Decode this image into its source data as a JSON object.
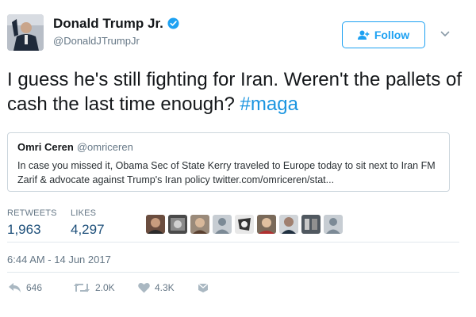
{
  "author": {
    "name": "Donald Trump Jr.",
    "handle": "@DonaldJTrumpJr",
    "avatar_icon": "profile-photo",
    "verified_icon": "verified-badge-icon",
    "verified_color": "#1da1f2"
  },
  "follow": {
    "label": "Follow",
    "icon": "add-person-icon",
    "color": "#1da1f2"
  },
  "menu": {
    "icon": "chevron-down-icon"
  },
  "tweet": {
    "text": "I guess he's still fighting for Iran. Weren't the pallets of cash the last time enough? ",
    "hashtag": "#maga",
    "hashtag_color": "#1b95e0"
  },
  "quote": {
    "name": "Omri Ceren",
    "handle": "@omriceren",
    "text": "In case you missed it, Obama Sec of State Kerry traveled to Europe today to sit next to Iran FM Zarif & advocate against Trump's Iran policy twitter.com/omriceren/stat..."
  },
  "stats": {
    "retweets_label": "RETWEETS",
    "retweets_value": "1,963",
    "likes_label": "LIKES",
    "likes_value": "4,297",
    "value_color": "#1d4f7a"
  },
  "likers": [
    "avatar-1",
    "avatar-2",
    "avatar-3",
    "avatar-4",
    "avatar-5",
    "avatar-6",
    "avatar-7",
    "avatar-8",
    "avatar-9"
  ],
  "timestamp": "6:44 AM - 14 Jun 2017",
  "actions": {
    "reply": {
      "icon": "reply-icon",
      "count": "646"
    },
    "retweet": {
      "icon": "retweet-icon",
      "count": "2.0K"
    },
    "like": {
      "icon": "heart-icon",
      "count": "4.3K"
    },
    "message": {
      "icon": "direct-message-icon"
    }
  }
}
